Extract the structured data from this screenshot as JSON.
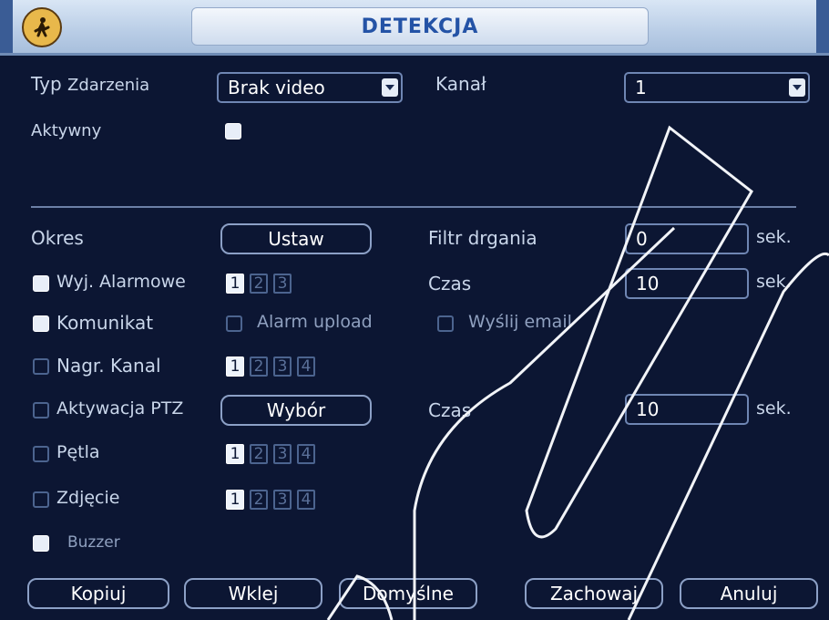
{
  "window": {
    "title": "DETEKCJA",
    "icon": "pedestrian-icon"
  },
  "event": {
    "type_label": "Typ",
    "type_label2": "Zdarzenia",
    "type_value": "Brak video",
    "channel_label": "Kanał",
    "channel_value": "1",
    "active_label": "Aktywny",
    "active_checked": false
  },
  "period": {
    "label": "Okres",
    "button": "Ustaw",
    "debounce_label": "Filtr drgania",
    "debounce_value": "0",
    "debounce_unit": "sek."
  },
  "alarm_out": {
    "label": "Wyj. Alarmowe",
    "checked": true,
    "channels": [
      "1",
      "2",
      "3"
    ],
    "selected": [
      "1"
    ],
    "time_label": "Czas",
    "time_value": "10",
    "time_unit": "sek."
  },
  "message": {
    "label": "Komunikat",
    "checked": true,
    "alarm_upload": "Alarm upload",
    "alarm_upload_checked": false,
    "send_email": "Wyślij email",
    "send_email_checked": false
  },
  "record": {
    "label": "Nagr. Kanal",
    "checked": false,
    "channels": [
      "1",
      "2",
      "3",
      "4"
    ],
    "selected": [
      "1"
    ]
  },
  "ptz": {
    "label": "Aktywacja PTZ",
    "checked": false,
    "button": "Wybór",
    "time_label": "Czas",
    "time_value": "10",
    "time_unit": "sek."
  },
  "tour": {
    "label": "Pętla",
    "checked": false,
    "channels": [
      "1",
      "2",
      "3",
      "4"
    ],
    "selected": [
      "1"
    ]
  },
  "snapshot": {
    "label": "Zdjęcie",
    "checked": false,
    "channels": [
      "1",
      "2",
      "3",
      "4"
    ],
    "selected": [
      "1"
    ]
  },
  "buzzer": {
    "label": "Buzzer",
    "checked": true
  },
  "footer": {
    "copy": "Kopiuj",
    "paste": "Wklej",
    "default": "Domyślne",
    "save": "Zachowaj",
    "cancel": "Anuluj"
  },
  "colors": {
    "background": "#0c1633",
    "title_text": "#2453a6",
    "frame": "#3a5c95"
  }
}
